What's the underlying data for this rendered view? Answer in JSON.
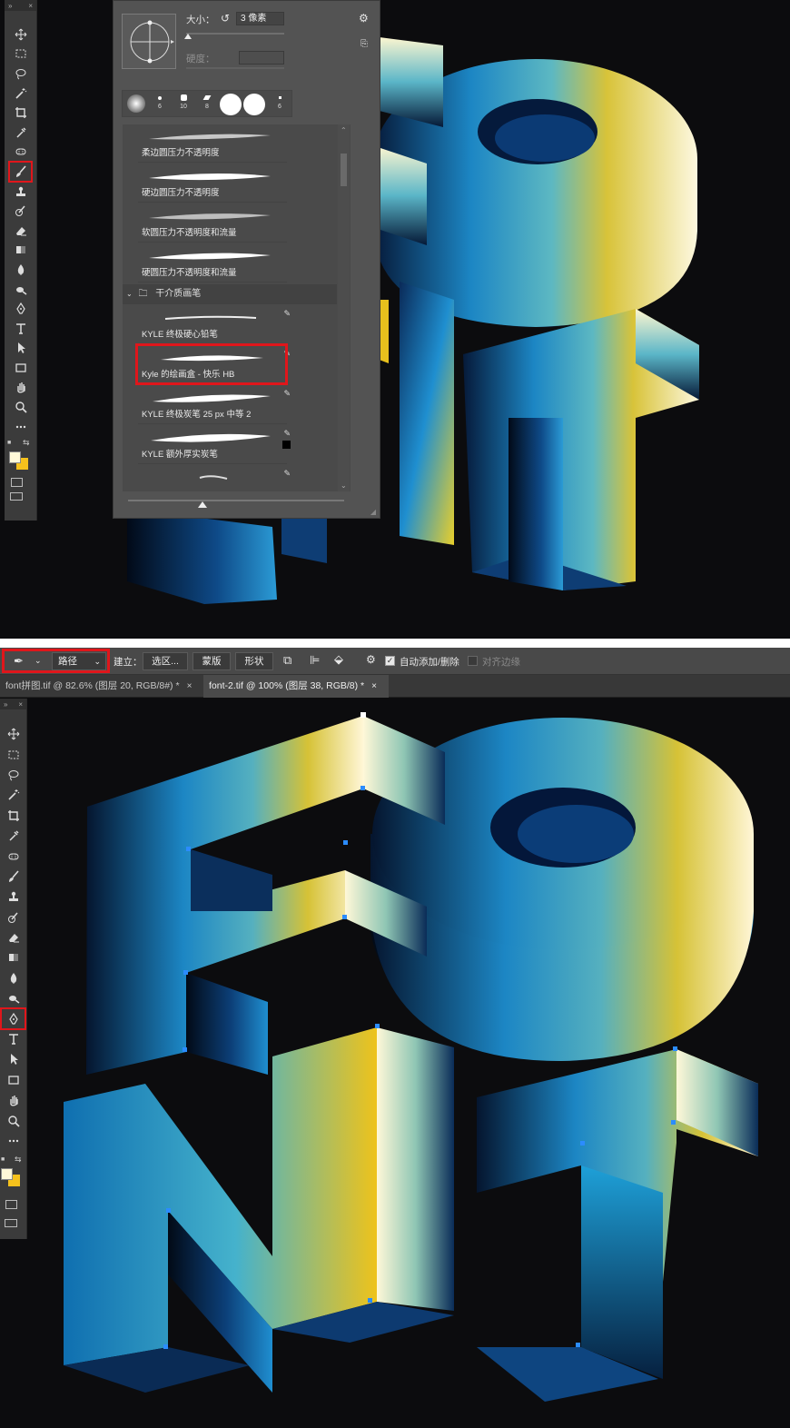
{
  "colors": {
    "highlight": "#e0161b",
    "toolbar_bg": "#3b3b3b",
    "panel_bg": "#535353",
    "foreground_swatch": "#fff9d8",
    "background_swatch": "#f5c11c"
  },
  "top_tools": [
    {
      "name": "move-tool",
      "icon": "move-icon"
    },
    {
      "name": "marquee-tool",
      "icon": "marquee-icon"
    },
    {
      "name": "lasso-tool",
      "icon": "lasso-icon"
    },
    {
      "name": "magic-wand-tool",
      "icon": "magic-wand-icon"
    },
    {
      "name": "crop-tool",
      "icon": "crop-icon"
    },
    {
      "name": "eyedropper-tool",
      "icon": "eyedropper-icon"
    },
    {
      "name": "healing-tool",
      "icon": "healing-icon"
    },
    {
      "name": "brush-tool",
      "icon": "brush-icon",
      "active": true
    },
    {
      "name": "clone-stamp-tool",
      "icon": "stamp-icon"
    },
    {
      "name": "history-brush-tool",
      "icon": "history-brush-icon"
    },
    {
      "name": "eraser-tool",
      "icon": "eraser-icon"
    },
    {
      "name": "gradient-tool",
      "icon": "gradient-icon"
    },
    {
      "name": "blur-tool",
      "icon": "blur-icon"
    },
    {
      "name": "dodge-tool",
      "icon": "dodge-icon"
    },
    {
      "name": "pen-tool",
      "icon": "pen-icon"
    },
    {
      "name": "type-tool",
      "icon": "type-icon"
    },
    {
      "name": "path-select-tool",
      "icon": "arrow-icon"
    },
    {
      "name": "rectangle-tool",
      "icon": "rectangle-icon"
    },
    {
      "name": "hand-tool",
      "icon": "hand-icon"
    },
    {
      "name": "zoom-tool",
      "icon": "zoom-icon"
    },
    {
      "name": "more-tools",
      "icon": "ellipsis-icon"
    }
  ],
  "bottom_tools_active": "pen-tool",
  "brush_panel": {
    "size_label": "大小：",
    "size_value": "3 像素",
    "hardness_label": "硬度：",
    "presets": [
      {
        "label": ""
      },
      {
        "label": "6"
      },
      {
        "label": "10"
      },
      {
        "label": "8"
      },
      {
        "label": ""
      },
      {
        "label": ""
      },
      {
        "label": "6"
      }
    ],
    "brushes_general": [
      {
        "name": "柔边圆压力不透明度"
      },
      {
        "name": "硬边圆压力不透明度"
      },
      {
        "name": "软圆压力不透明度和流量"
      },
      {
        "name": "硬圆压力不透明度和流量"
      }
    ],
    "group_name": "干介质画笔",
    "brushes_dry": [
      {
        "name": "KYLE 终极硬心铅笔"
      },
      {
        "name": "Kyle 的绘画盒 - 快乐 HB",
        "selected": true
      },
      {
        "name": "KYLE 终极炭笔 25 px 中等 2"
      },
      {
        "name": "KYLE 额外厚实炭笔"
      },
      {
        "name": ""
      }
    ]
  },
  "options_bar": {
    "mode_value": "路径",
    "make_label": "建立：",
    "selection_button": "选区...",
    "mask_button": "蒙版",
    "shape_button": "形状",
    "auto_add_delete": "自动添加/删除",
    "align_edges": "对齐边缘"
  },
  "tabs": [
    {
      "label": "font拼图.tif @ 82.6% (图层 20, RGB/8#) *",
      "active": false
    },
    {
      "label": "font-2.tif @ 100% (图层 38, RGB/8) *",
      "active": true
    }
  ]
}
